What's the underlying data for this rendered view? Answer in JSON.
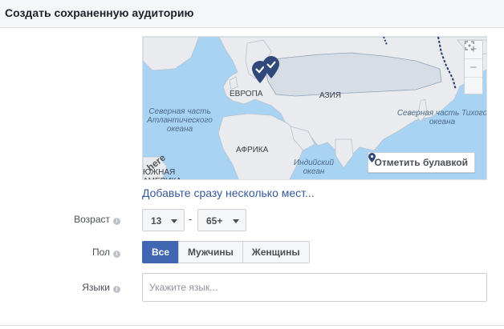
{
  "header": {
    "title": "Создать сохраненную аудиторию"
  },
  "map": {
    "labels": {
      "europe": "ЕВРОПА",
      "asia": "АЗИЯ",
      "africa": "АФРИКА",
      "north_atlantic": "Северная часть Атлантического океана",
      "north_pacific": "Северная часть Тихого океана",
      "indian_ocean": "Индийский океан",
      "south_america": "ЮЖНАЯ АМЕРИКА"
    },
    "zoom_in": "+",
    "zoom_out": "−",
    "fullscreen_icon": "fullscreen-icon",
    "pin_button": "Отметить булавкой",
    "attribution": "here"
  },
  "add_locations_link": "Добавьте сразу несколько мест...",
  "age": {
    "label": "Возраст",
    "min": "13",
    "max": "65+"
  },
  "gender": {
    "label": "Пол",
    "options": [
      "Все",
      "Мужчины",
      "Женщины"
    ],
    "selected": "Все"
  },
  "languages": {
    "label": "Языки",
    "placeholder": "Укажите язык...",
    "value": ""
  },
  "colors": {
    "accent": "#4267b2",
    "link": "#365899",
    "pin": "#2f4a7a"
  }
}
